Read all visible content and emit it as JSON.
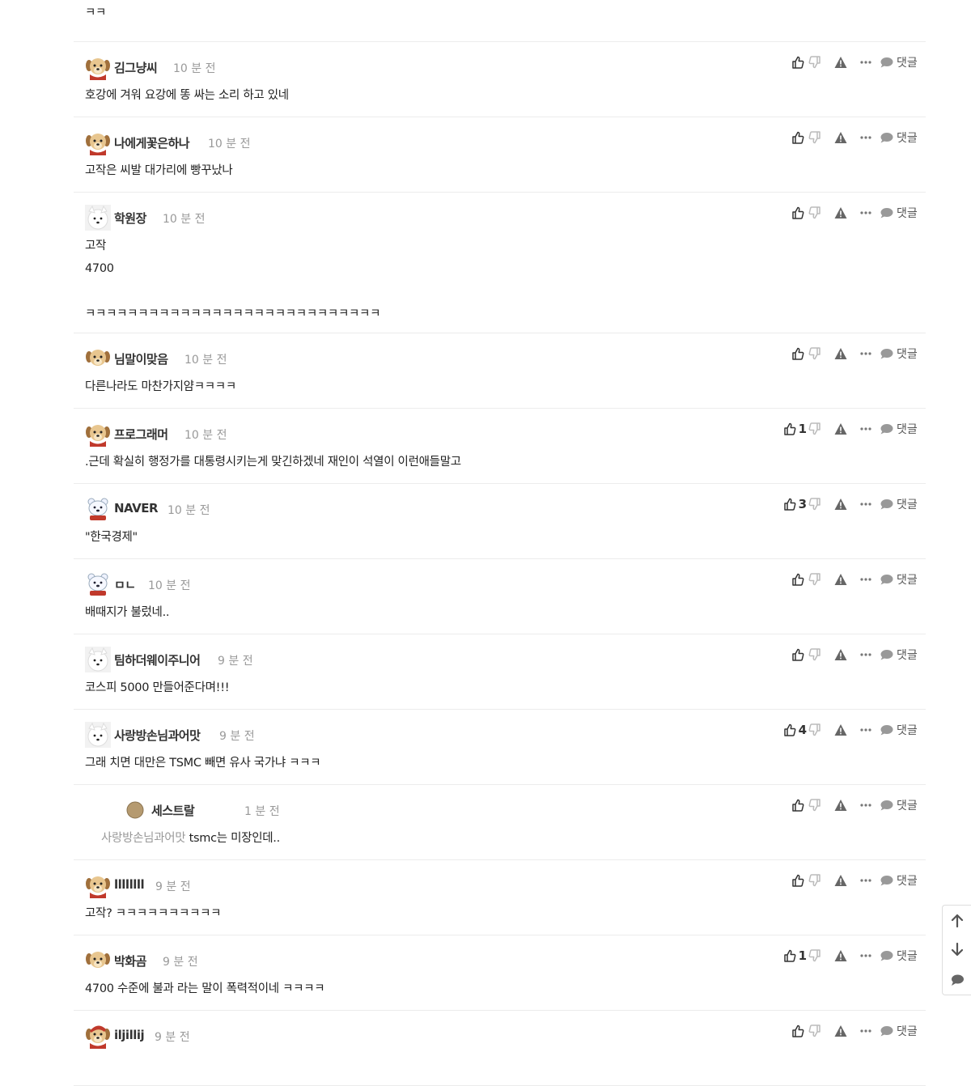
{
  "action_labels": {
    "reply": "댓글"
  },
  "icons": {
    "like": "thumbs-up-icon",
    "dislike": "thumbs-down-icon",
    "report": "warning-icon",
    "more": "more-icon",
    "reply": "speech-bubble-icon"
  },
  "comments": [
    {
      "user": "",
      "time": "",
      "text": "ㅋㅋ",
      "likes": ""
    },
    {
      "user": "김그냥씨",
      "time": "10 분 전",
      "text": "호강에 겨워 요강에 똥 싸는 소리 하고 있네",
      "likes": "",
      "avatar": "puppy-red"
    },
    {
      "user": "나에게꽃은하나",
      "time": "10 분 전",
      "text": "고작은 씨발 대가리에 빵꾸났나",
      "likes": "",
      "avatar": "puppy-red"
    },
    {
      "user": "학원장",
      "time": "10 분 전",
      "text": "고작\n4700\n\nㅋㅋㅋㅋㅋㅋㅋㅋㅋㅋㅋㅋㅋㅋㅋㅋㅋㅋㅋㅋㅋㅋㅋㅋㅋㅋㅋㅋ",
      "likes": "",
      "avatar": "white-dog"
    },
    {
      "user": "님말이맞음",
      "time": "10 분 전",
      "text": "다른나라도 마찬가지얌ㅋㅋㅋㅋ",
      "likes": "",
      "avatar": "puppy"
    },
    {
      "user": "프로그래머",
      "time": "10 분 전",
      "text": ".근데 확실히 행정가를 대통령시키는게 맞긴하겠네 재인이 석열이 이런애들말고",
      "likes": "1",
      "avatar": "puppy-red"
    },
    {
      "user": "NAVER",
      "time": "10 분 전",
      "text": "\"한국경제\"",
      "likes": "3",
      "avatar": "polar-bear"
    },
    {
      "user": "ㅁㄴ",
      "time": "10 분 전",
      "text": "배때지가 불렀네..",
      "likes": "",
      "avatar": "polar-bear"
    },
    {
      "user": "팀하더웨이주니어",
      "time": "9 분 전",
      "text": "코스피 5000 만들어준다며!!!",
      "likes": "",
      "avatar": "white-dog"
    },
    {
      "user": "사랑방손님과어맛",
      "time": "9 분 전",
      "text": "그래 치면 대만은 TSMC 빼면 유사 국가냐 ㅋㅋㅋ",
      "likes": "4",
      "avatar": "white-dog"
    },
    {
      "user": "세스트랄",
      "time": "1 분 전",
      "mention": "사랑방손님과어맛",
      "text": "tsmc는 미장인데..",
      "likes": "",
      "avatar": "circle",
      "is_reply": true
    },
    {
      "user": "llllllll",
      "time": "9 분 전",
      "text": "고작? ㅋㅋㅋㅋㅋㅋㅋㅋㅋㅋ",
      "likes": "",
      "avatar": "puppy-red"
    },
    {
      "user": "박화곰",
      "time": "9 분 전",
      "text": "4700 수준에 불과 라는 말이 폭력적이네 ㅋㅋㅋㅋ",
      "likes": "1",
      "avatar": "puppy"
    },
    {
      "user": "iljillij",
      "time": "9 분 전",
      "text": "",
      "likes": "",
      "avatar": "santa-puppy"
    }
  ],
  "float_nav": {
    "icons": [
      "arrow-up-icon",
      "arrow-down-icon",
      "comment-icon"
    ]
  }
}
